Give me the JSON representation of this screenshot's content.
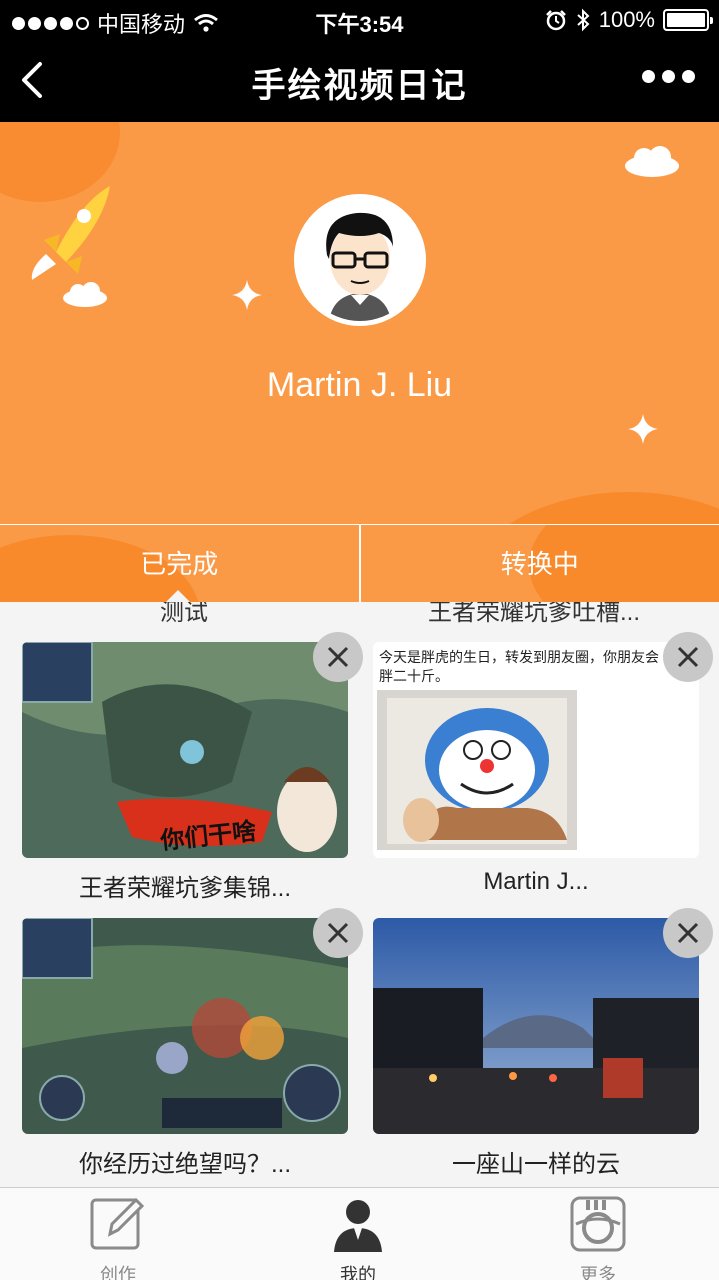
{
  "status_bar": {
    "carrier": "中国移动",
    "time": "下午3:54",
    "battery": "100%"
  },
  "nav": {
    "title": "手绘视频日记"
  },
  "profile": {
    "name": "Martin J. Liu"
  },
  "tabs": [
    {
      "label": "已完成"
    },
    {
      "label": "转换中"
    }
  ],
  "partial_titles": [
    "测试",
    "王者荣耀坑爹吐槽..."
  ],
  "videos": [
    {
      "title": "王者荣耀坑爹集锦...",
      "thumb_text": "你们干啥"
    },
    {
      "title": "Martin J...",
      "thumb_text": "今天是胖虎的生日，转发到朋友圈，你朋友会胖二十斤。"
    },
    {
      "title": "你经历过绝望吗？..."
    },
    {
      "title": "一座山一样的云"
    }
  ],
  "tabbar": [
    {
      "label": "创作"
    },
    {
      "label": "我的"
    },
    {
      "label": "更多"
    }
  ],
  "colors": {
    "header_orange": "#fb9a46",
    "accent_orange": "#f88a2c"
  }
}
